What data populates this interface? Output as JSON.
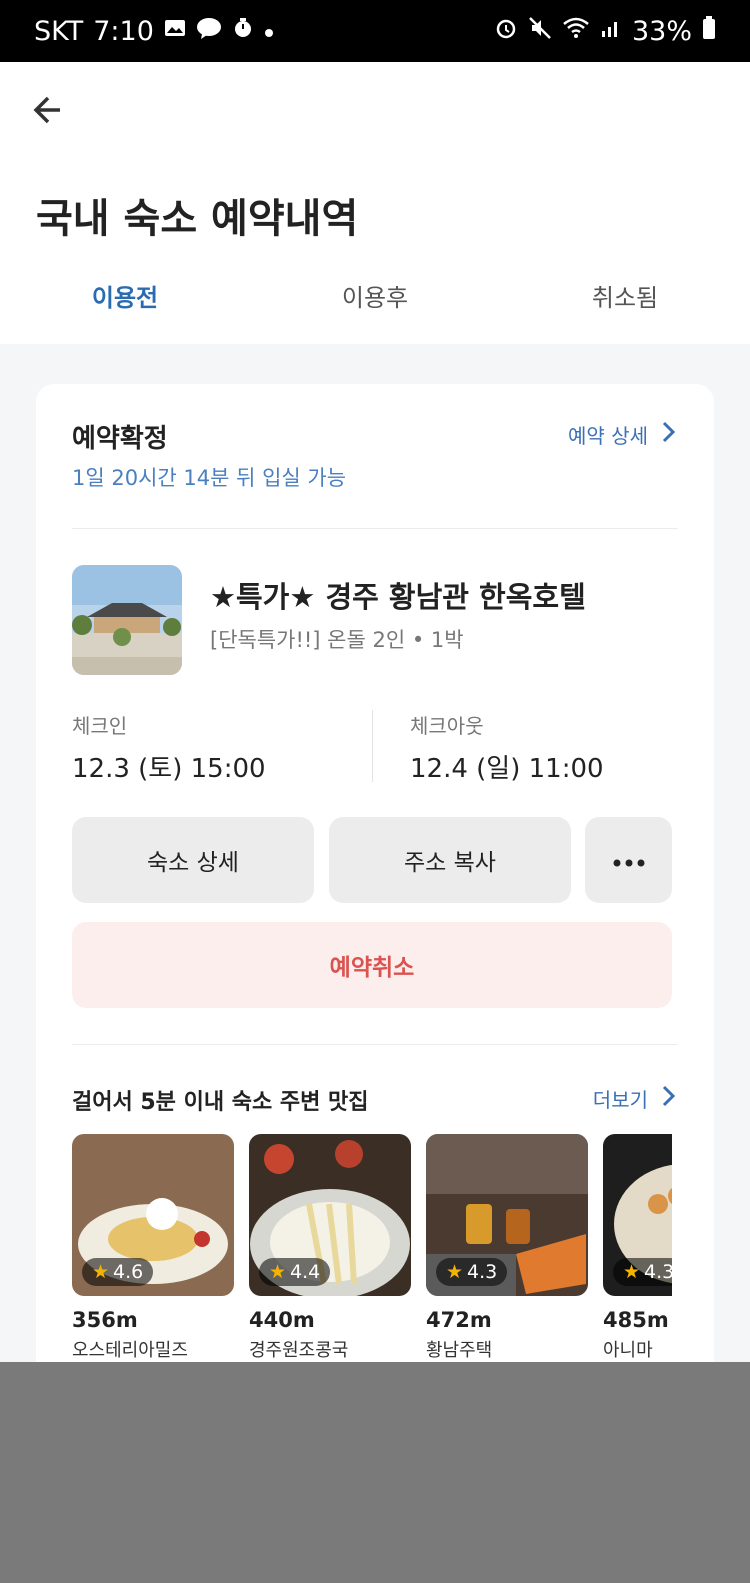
{
  "status_bar": {
    "carrier": "SKT",
    "time": "7:10",
    "battery": "33%",
    "left_icons": [
      "gallery-icon",
      "kakaotalk-icon",
      "timer-icon",
      "dot-icon"
    ],
    "right_icons": [
      "alarm-icon",
      "mute-icon",
      "wifi-icon",
      "signal-icon",
      "battery-icon"
    ]
  },
  "header": {
    "back_icon": "arrow-left-icon",
    "title": "국내 숙소 예약내역"
  },
  "tabs": [
    {
      "label": "이용전",
      "active": true
    },
    {
      "label": "이용후",
      "active": false
    },
    {
      "label": "취소됨",
      "active": false
    }
  ],
  "reservation": {
    "status": "예약확정",
    "checkin_countdown": "1일 20시간 14분 뒤 입실 가능",
    "detail_link": "예약 상세",
    "hotel_name": "★특가★ 경주 황남관 한옥호텔",
    "room_info": "[단독특가!!] 온돌 2인 • 1박",
    "checkin_label": "체크인",
    "checkin_value": "12.3 (토) 15:00",
    "checkout_label": "체크아웃",
    "checkout_value": "12.4 (일) 11:00",
    "buttons": {
      "detail": "숙소 상세",
      "copy_address": "주소 복사",
      "more_icon": "more-horizontal-icon",
      "cancel": "예약취소"
    }
  },
  "nearby": {
    "title": "걸어서 5분 이내 숙소 주변 맛집",
    "more_link": "더보기",
    "restaurants": [
      {
        "rating": "4.6",
        "distance": "356m",
        "name": "오스테리아밀즈"
      },
      {
        "rating": "4.4",
        "distance": "440m",
        "name": "경주원조콩국"
      },
      {
        "rating": "4.3",
        "distance": "472m",
        "name": "황남주택"
      },
      {
        "rating": "4.3",
        "distance": "485m",
        "name": "아니마"
      }
    ]
  },
  "colors": {
    "accent": "#2b6cb0",
    "cancel_text": "#d9534f",
    "cancel_bg": "#fdeeee",
    "card_bg": "#ffffff",
    "page_bg": "#f5f6f8"
  }
}
